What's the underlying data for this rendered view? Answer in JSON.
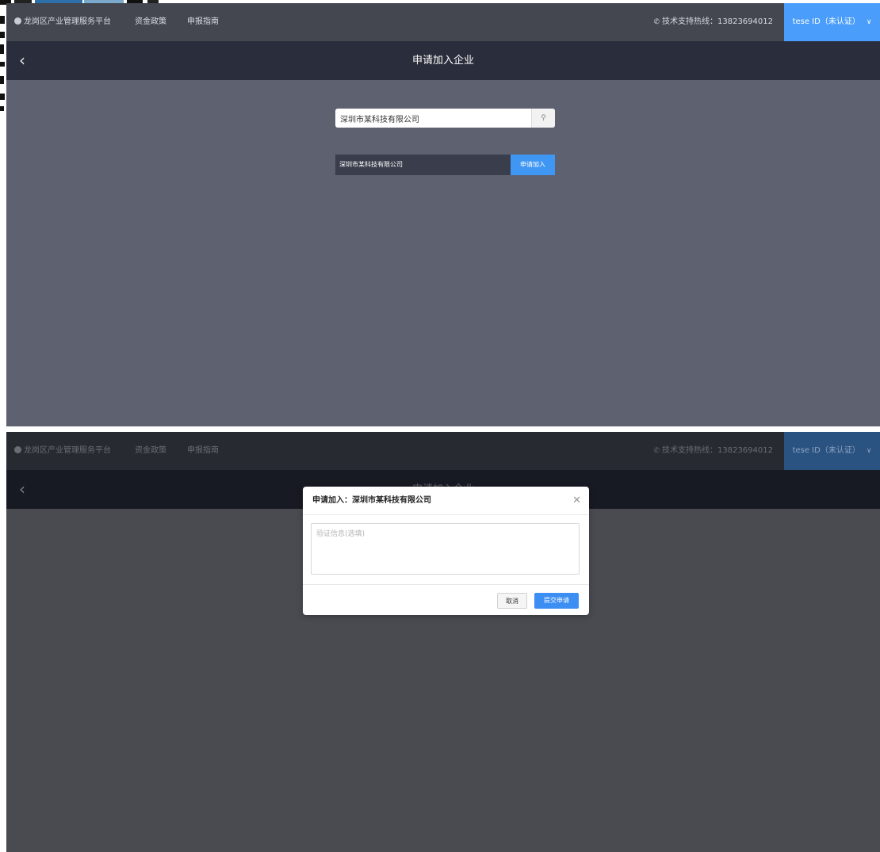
{
  "colors": {
    "topbar": "#44474f",
    "subbar": "#2a2d3b",
    "content": "#5d6170",
    "accent": "#4a9dfa",
    "overlay_content": "#494b51"
  },
  "screen1": {
    "header": {
      "brand_icon": "leaf-logo-icon",
      "brand": "龙岗区产业管理服务平台",
      "nav": [
        "资金政策",
        "申报指南"
      ],
      "hotline_icon": "phone-icon",
      "hotline": "技术支持热线：13823694012",
      "user": "tese ID（未认证）",
      "user_icon": "chevron-down-icon"
    },
    "subheader": {
      "back_icon": "chevron-left-icon",
      "title": "申请加入企业"
    },
    "search": {
      "value": "深圳市某科技有限公司",
      "icon": "search-icon"
    },
    "results": [
      {
        "name": "深圳市某科技有限公司",
        "action": "申请加入"
      }
    ]
  },
  "screen2": {
    "header": {
      "brand": "龙岗区产业管理服务平台",
      "nav": [
        "资金政策",
        "申报指南"
      ],
      "hotline": "技术支持热线：13823694012",
      "user": "tese ID（未认证）"
    },
    "subheader": {
      "title": "申请加入企业"
    },
    "modal": {
      "title": "申请加入：深圳市某科技有限公司",
      "close_icon": "close-icon",
      "placeholder": "验证信息(选填)",
      "cancel": "取消",
      "submit": "提交申请"
    }
  }
}
